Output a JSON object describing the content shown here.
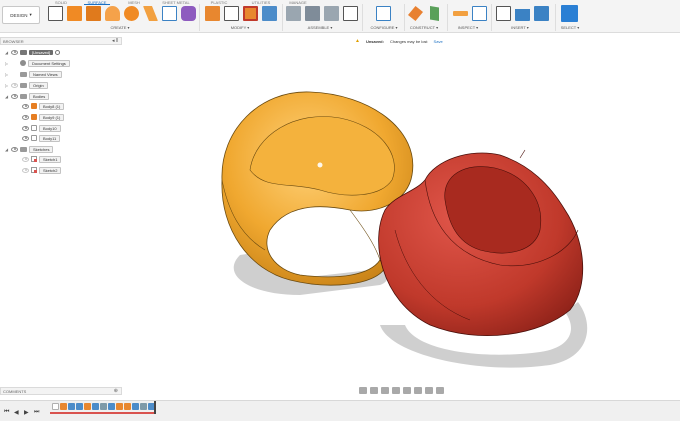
{
  "toolbar": {
    "design_label": "DESIGN",
    "tabs": [
      "SOLID",
      "SURFACE",
      "MESH",
      "SHEET METAL",
      "PLASTIC",
      "UTILITIES",
      "MANAGE"
    ],
    "active_tab": "SURFACE",
    "groups": [
      "CREATE ▾",
      "MODIFY ▾",
      "ASSEMBLE ▾",
      "CONFIGURE ▾",
      "CONSTRUCT ▾",
      "INSPECT ▾",
      "INSERT ▾",
      "SELECT ▾"
    ]
  },
  "browser": {
    "title": "BROWSER",
    "controls": "◂ ‖",
    "document_name": "[Unsaved]",
    "items": [
      "Document Settings",
      "Named Views",
      "Origin",
      "Bodies",
      "Body8 (1)",
      "Body9 (1)",
      "Body10",
      "Body11",
      "Sketches",
      "Sketch1",
      "Sketch2"
    ]
  },
  "banner": {
    "status": "Unsaved:",
    "message": "Changes may be lost",
    "save": "Save"
  },
  "comments": {
    "title": "COMMENTS",
    "control": "⊕"
  },
  "timeline": {
    "controls": [
      "⏮",
      "◀",
      "▶",
      "⏭"
    ]
  },
  "colors": {
    "body_orange": "#f0a830",
    "body_red": "#c0392b",
    "accent": "#1a6fc2"
  }
}
